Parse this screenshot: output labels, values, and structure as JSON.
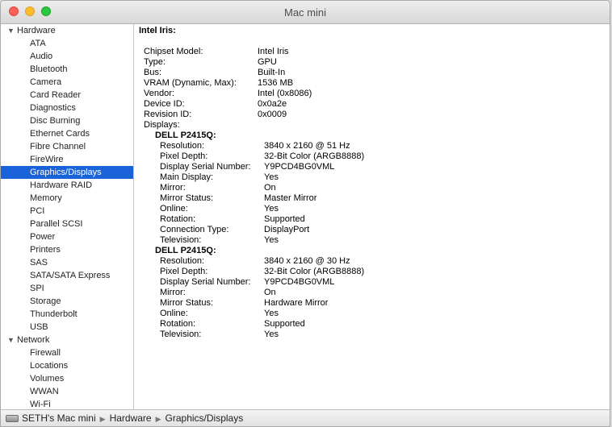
{
  "window": {
    "title": "Mac mini"
  },
  "sidebar": {
    "groups": [
      {
        "label": "Hardware",
        "items": [
          "ATA",
          "Audio",
          "Bluetooth",
          "Camera",
          "Card Reader",
          "Diagnostics",
          "Disc Burning",
          "Ethernet Cards",
          "Fibre Channel",
          "FireWire",
          "Graphics/Displays",
          "Hardware RAID",
          "Memory",
          "PCI",
          "Parallel SCSI",
          "Power",
          "Printers",
          "SAS",
          "SATA/SATA Express",
          "SPI",
          "Storage",
          "Thunderbolt",
          "USB"
        ]
      },
      {
        "label": "Network",
        "items": [
          "Firewall",
          "Locations",
          "Volumes",
          "WWAN",
          "Wi-Fi"
        ]
      }
    ],
    "selected": "Graphics/Displays"
  },
  "content": {
    "heading": "Intel Iris:",
    "properties": [
      {
        "k": "Chipset Model:",
        "v": "Intel Iris"
      },
      {
        "k": "Type:",
        "v": "GPU"
      },
      {
        "k": "Bus:",
        "v": "Built-In"
      },
      {
        "k": "VRAM (Dynamic, Max):",
        "v": "1536 MB"
      },
      {
        "k": "Vendor:",
        "v": "Intel (0x8086)"
      },
      {
        "k": "Device ID:",
        "v": "0x0a2e"
      },
      {
        "k": "Revision ID:",
        "v": "0x0009"
      }
    ],
    "displays_label": "Displays:",
    "displays": [
      {
        "name": "DELL P2415Q:",
        "props": [
          {
            "k": "Resolution:",
            "v": "3840 x 2160 @ 51 Hz"
          },
          {
            "k": "Pixel Depth:",
            "v": "32-Bit Color (ARGB8888)"
          },
          {
            "k": "Display Serial Number:",
            "v": "Y9PCD4BG0VML"
          },
          {
            "k": "Main Display:",
            "v": "Yes"
          },
          {
            "k": "Mirror:",
            "v": "On"
          },
          {
            "k": "Mirror Status:",
            "v": "Master Mirror"
          },
          {
            "k": "Online:",
            "v": "Yes"
          },
          {
            "k": "Rotation:",
            "v": "Supported"
          },
          {
            "k": "Connection Type:",
            "v": "DisplayPort"
          },
          {
            "k": "Television:",
            "v": "Yes"
          }
        ]
      },
      {
        "name": "DELL P2415Q:",
        "props": [
          {
            "k": "Resolution:",
            "v": "3840 x 2160 @ 30 Hz"
          },
          {
            "k": "Pixel Depth:",
            "v": "32-Bit Color (ARGB8888)"
          },
          {
            "k": "Display Serial Number:",
            "v": "Y9PCD4BG0VML"
          },
          {
            "k": "Mirror:",
            "v": "On"
          },
          {
            "k": "Mirror Status:",
            "v": "Hardware Mirror"
          },
          {
            "k": "Online:",
            "v": "Yes"
          },
          {
            "k": "Rotation:",
            "v": "Supported"
          },
          {
            "k": "Television:",
            "v": "Yes"
          }
        ]
      }
    ]
  },
  "statusbar": {
    "path": [
      "SETH's Mac mini",
      "Hardware",
      "Graphics/Displays"
    ],
    "separator": "▶"
  },
  "colors": {
    "selection": "#1a62d7"
  },
  "icons": [
    "close-button",
    "minimize-button",
    "zoom-button",
    "disclosure-triangle-icon",
    "computer-icon"
  ]
}
